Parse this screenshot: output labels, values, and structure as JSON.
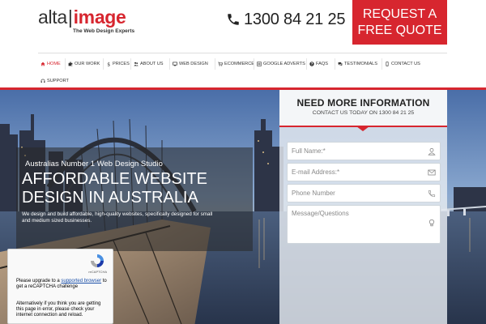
{
  "header": {
    "logo": {
      "left": "alta",
      "separator": "|",
      "right": "image",
      "tagline": "The Web Design Experts"
    },
    "phone": "1300 84 21 25",
    "quote_button": {
      "line1": "REQUEST A",
      "line2": "FREE QUOTE"
    }
  },
  "nav": {
    "items": [
      {
        "label": "HOME",
        "icon": "home-icon"
      },
      {
        "label": "OUR WORK",
        "icon": "puzzle-icon"
      },
      {
        "label": "PRICES",
        "icon": "dollar-icon"
      },
      {
        "label": "ABOUT US",
        "icon": "users-icon"
      },
      {
        "label": "WEB DESIGN",
        "icon": "monitor-icon"
      },
      {
        "label": "ECOMMERCE",
        "icon": "cart-icon"
      },
      {
        "label": "GOOGLE ADVERTS",
        "icon": "list-icon"
      },
      {
        "label": "FAQS",
        "icon": "question-icon"
      },
      {
        "label": "TESTIMONIALS",
        "icon": "comments-icon"
      },
      {
        "label": "CONTACT US",
        "icon": "mobile-icon"
      },
      {
        "label": "SUPPORT",
        "icon": "headset-icon"
      }
    ]
  },
  "hero": {
    "subtitle": "Australias Number 1 Web Design Studio",
    "title": "AFFORDABLE WEBSITE DESIGN IN AUSTRALIA",
    "description": "We design and build affordable, high-quality websites, specifically designed for small and medium sized businesses."
  },
  "form": {
    "title": "NEED MORE INFORMATION",
    "subtitle": "CONTACT US TODAY ON 1300 84 21 25",
    "fields": {
      "name_placeholder": "Full Name:*",
      "email_placeholder": "E-mail Address:*",
      "phone_placeholder": "Phone Number",
      "message_placeholder": "Message/Questions"
    },
    "captcha": {
      "label": "reCAPTCHA",
      "text_before": "Please upgrade to a",
      "link": "supported browser",
      "text_after": "to get a reCAPTCHA challenge",
      "alt_text": "Alternatively if you think you are getting this page in error, please check your internet connection and reload."
    }
  },
  "colors": {
    "accent": "#d7262f"
  }
}
